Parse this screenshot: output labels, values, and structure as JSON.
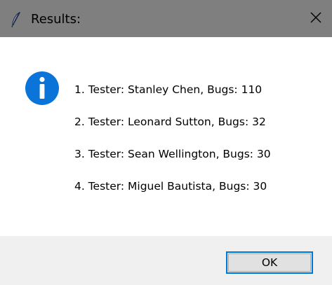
{
  "window": {
    "title": "Results:",
    "app_icon": "feather-icon",
    "close_icon": "close-icon"
  },
  "message": {
    "icon": "info-icon",
    "lines": [
      "1. Tester: Stanley Chen, Bugs: 110",
      "2. Tester: Leonard Sutton, Bugs: 32",
      "3. Tester: Sean Wellington, Bugs: 30",
      "4. Tester: Miguel Bautista, Bugs: 30"
    ]
  },
  "buttons": {
    "ok_label": "OK"
  },
  "colors": {
    "titlebar": "#7f7f7f",
    "info_icon": "#0a74d9",
    "ok_border": "#0078d7",
    "footer": "#f0f0f0"
  }
}
